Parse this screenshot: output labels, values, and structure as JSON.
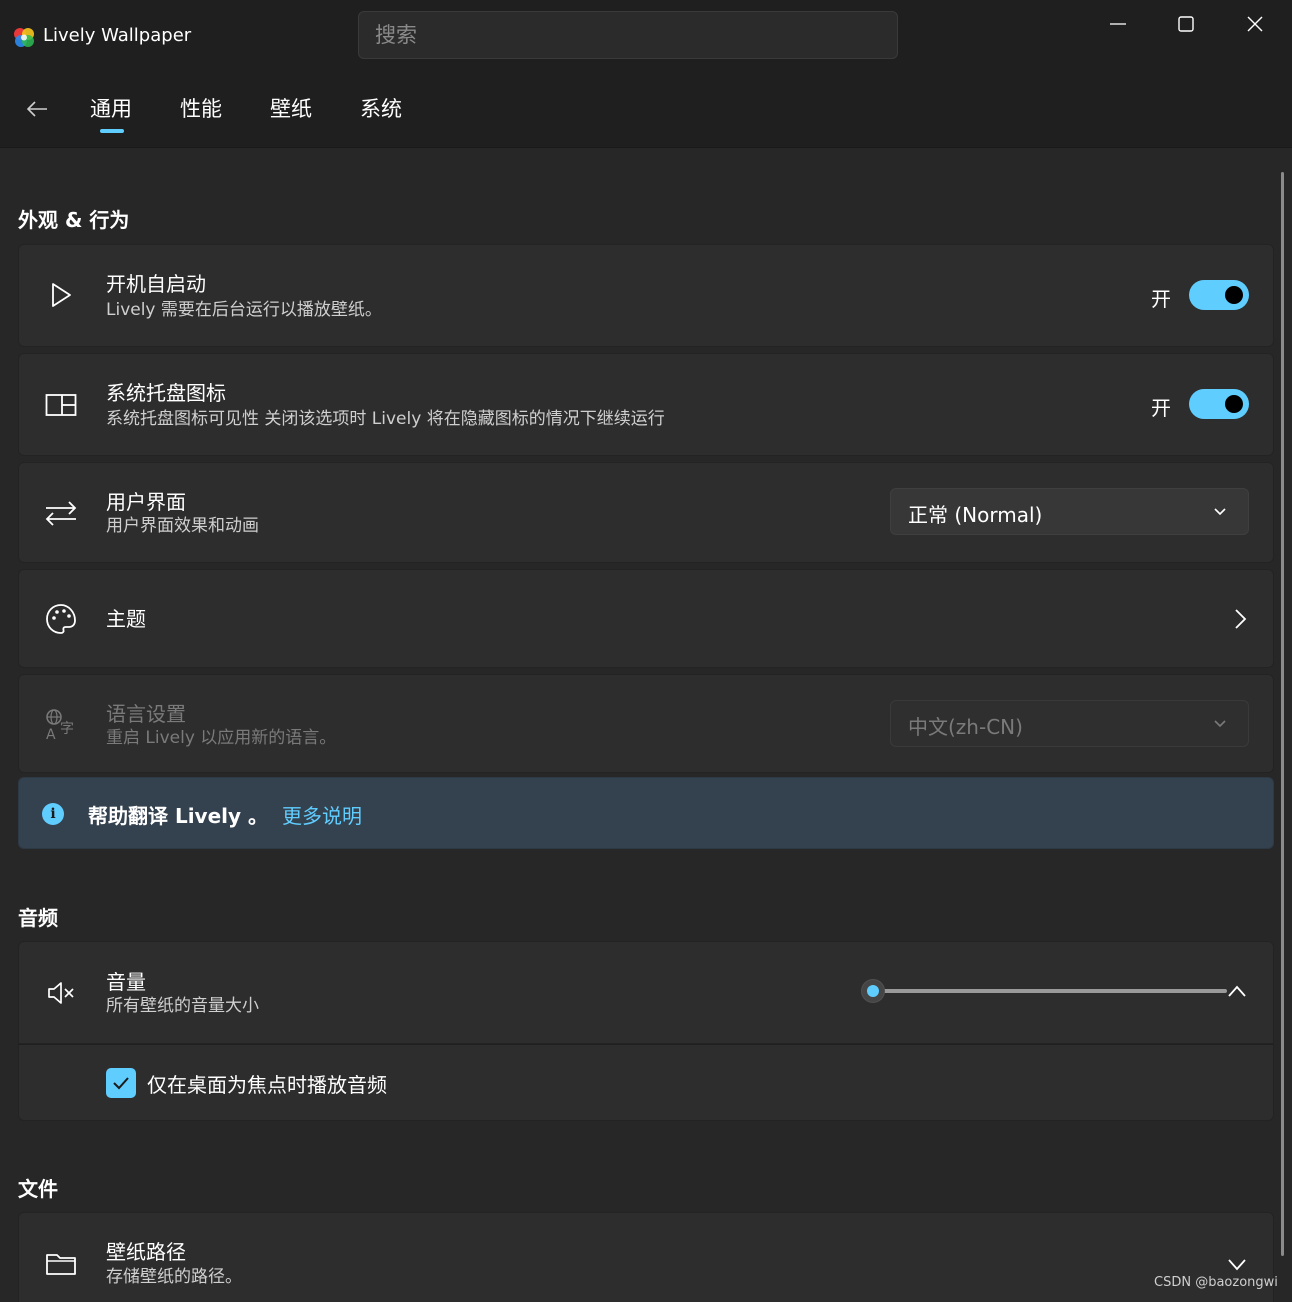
{
  "app": {
    "title": "Lively Wallpaper"
  },
  "search": {
    "placeholder": "搜索"
  },
  "tabs": [
    {
      "label": "通用",
      "selected": true
    },
    {
      "label": "性能"
    },
    {
      "label": "壁纸"
    },
    {
      "label": "系统"
    }
  ],
  "sections": {
    "appearance": "外观 & 行为",
    "audio": "音频",
    "files": "文件"
  },
  "settings": {
    "startup": {
      "title": "开机自启动",
      "desc": "Lively 需要在后台运行以播放壁纸。",
      "state_label": "开",
      "on": true
    },
    "tray": {
      "title": "系统托盘图标",
      "desc": "系统托盘图标可见性 关闭该选项时 Lively 将在隐藏图标的情况下继续运行",
      "state_label": "开",
      "on": true
    },
    "ui": {
      "title": "用户界面",
      "desc": "用户界面效果和动画",
      "value": "正常 (Normal)"
    },
    "theme": {
      "title": "主题"
    },
    "language": {
      "title": "语言设置",
      "desc": "重启 Lively 以应用新的语言。",
      "value": "中文(zh-CN)",
      "disabled": true
    },
    "volume": {
      "title": "音量",
      "desc": "所有壁纸的音量大小",
      "level": 0
    },
    "desktop_audio": {
      "label": "仅在桌面为焦点时播放音频",
      "checked": true
    },
    "wallpaper_path": {
      "title": "壁纸路径",
      "desc": "存储壁纸的路径。"
    }
  },
  "infobar": {
    "text": "帮助翻译 Lively 。",
    "link": "更多说明"
  },
  "watermark": "CSDN @baozongwi",
  "colors": {
    "accent": "#60cdff",
    "background": "#202020",
    "card": "#2d2d2d",
    "info": "#34414f"
  }
}
